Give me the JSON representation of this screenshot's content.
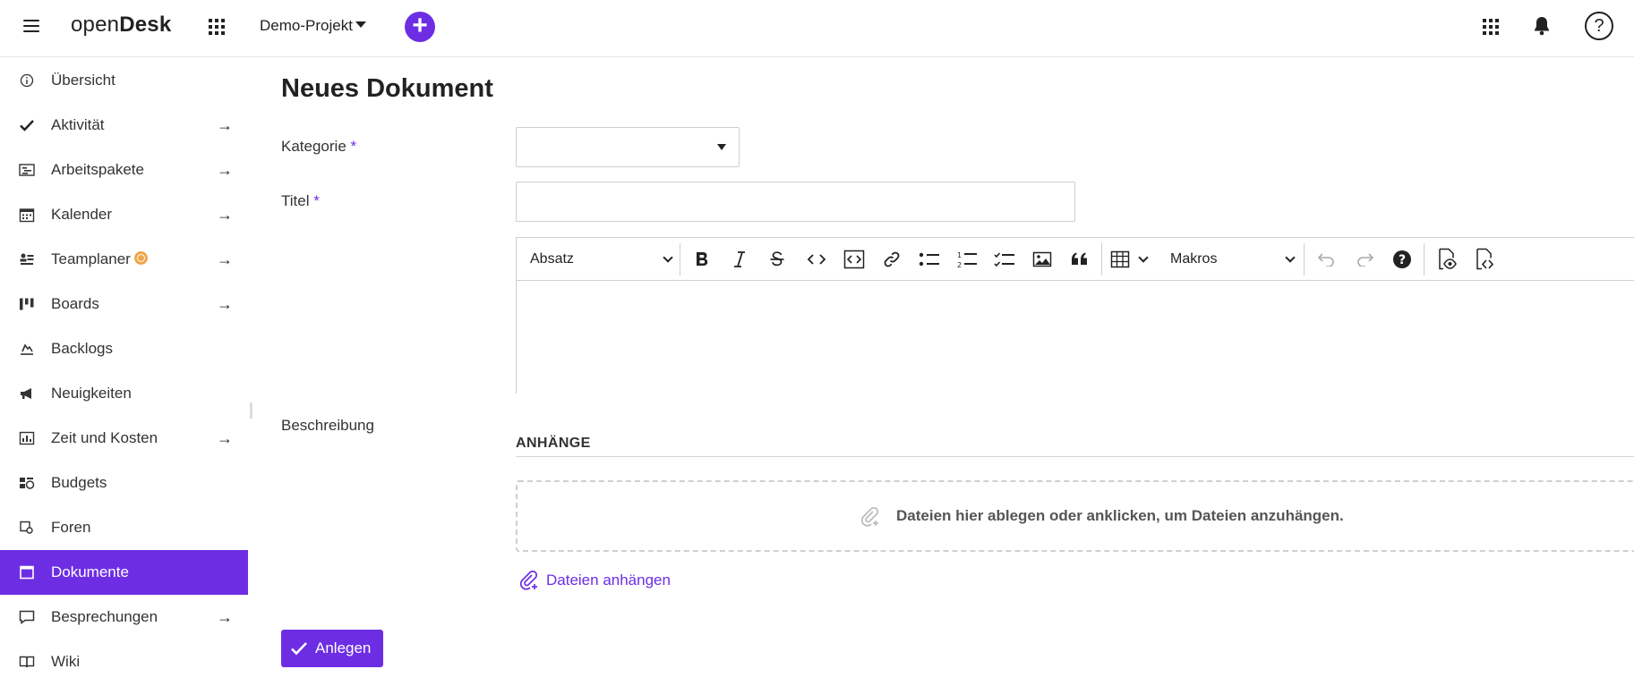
{
  "header": {
    "logo_light": "open",
    "logo_bold": "Desk",
    "project": "Demo-Projekt",
    "help": "?"
  },
  "sidebar": {
    "items": [
      {
        "label": "Übersicht",
        "icon": "info-icon",
        "arrow": false
      },
      {
        "label": "Aktivität",
        "icon": "check-icon",
        "arrow": true
      },
      {
        "label": "Arbeitspakete",
        "icon": "work-packages-icon",
        "arrow": true
      },
      {
        "label": "Kalender",
        "icon": "calendar-icon",
        "arrow": true
      },
      {
        "label": "Teamplaner",
        "icon": "team-planner-icon",
        "arrow": true
      },
      {
        "label": "Boards",
        "icon": "boards-icon",
        "arrow": true
      },
      {
        "label": "Backlogs",
        "icon": "backlogs-icon",
        "arrow": false
      },
      {
        "label": "Neuigkeiten",
        "icon": "megaphone-icon",
        "arrow": false
      },
      {
        "label": "Zeit und Kosten",
        "icon": "cost-report-icon",
        "arrow": true
      },
      {
        "label": "Budgets",
        "icon": "budget-icon",
        "arrow": false
      },
      {
        "label": "Foren",
        "icon": "forum-icon",
        "arrow": false
      },
      {
        "label": "Dokumente",
        "icon": "documents-icon",
        "arrow": false,
        "active": true
      },
      {
        "label": "Besprechungen",
        "icon": "meetings-icon",
        "arrow": true
      },
      {
        "label": "Wiki",
        "icon": "wiki-icon",
        "arrow": false
      }
    ]
  },
  "form": {
    "title": "Neues Dokument",
    "category_label": "Kategorie",
    "title_label": "Titel",
    "description_label": "Beschreibung",
    "required_mark": "*",
    "category_value": "",
    "title_value": ""
  },
  "editor": {
    "paragraph_style": "Absatz",
    "macros": "Makros"
  },
  "attachments": {
    "heading": "ANHÄNGE",
    "dropzone_text": "Dateien hier ablegen oder anklicken, um Dateien anzuhängen.",
    "attach_link": "Dateien anhängen"
  },
  "submit": {
    "label": "Anlegen"
  },
  "colors": {
    "accent": "#6d2ee3",
    "badge": "#f0a64a"
  }
}
